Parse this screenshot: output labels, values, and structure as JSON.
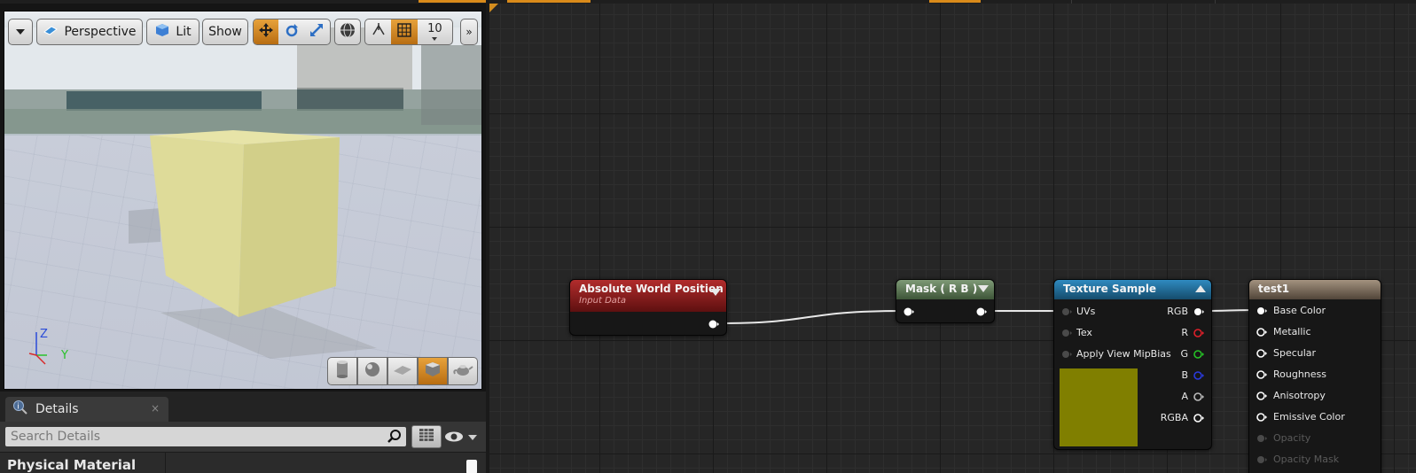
{
  "viewport": {
    "toolbar": {
      "perspective_label": "Perspective",
      "lit_label": "Lit",
      "show_label": "Show",
      "grid_snap_value": "10"
    },
    "axis": {
      "z": "Z",
      "y": "Y"
    }
  },
  "details": {
    "tab_label": "Details",
    "close_label": "×",
    "search_placeholder": "Search Details",
    "category_label": "Physical Material"
  },
  "graph": {
    "nodes": {
      "abs_world_pos": {
        "title": "Absolute World Position",
        "subtitle": "Input Data"
      },
      "mask": {
        "title": "Mask ( R B )"
      },
      "texture_sample": {
        "title": "Texture Sample",
        "inputs": [
          "UVs",
          "Tex",
          "Apply View MipBias"
        ],
        "outputs": [
          "RGB",
          "R",
          "G",
          "B",
          "A",
          "RGBA"
        ],
        "preview_color": "#807f00"
      },
      "material": {
        "title": "test1",
        "inputs": [
          "Base Color",
          "Metallic",
          "Specular",
          "Roughness",
          "Anisotropy",
          "Emissive Color",
          "Opacity",
          "Opacity Mask"
        ]
      }
    }
  },
  "colors": {
    "accent": "#d98a1a",
    "input_node_header": "#8a1a1a",
    "mask_node_header": "#5f7a5a",
    "texture_node_header": "#1f6a93",
    "material_node_header": "#7a6a5a",
    "pin_r": "#e0202a",
    "pin_g": "#26c226",
    "pin_b": "#2a3adf"
  }
}
